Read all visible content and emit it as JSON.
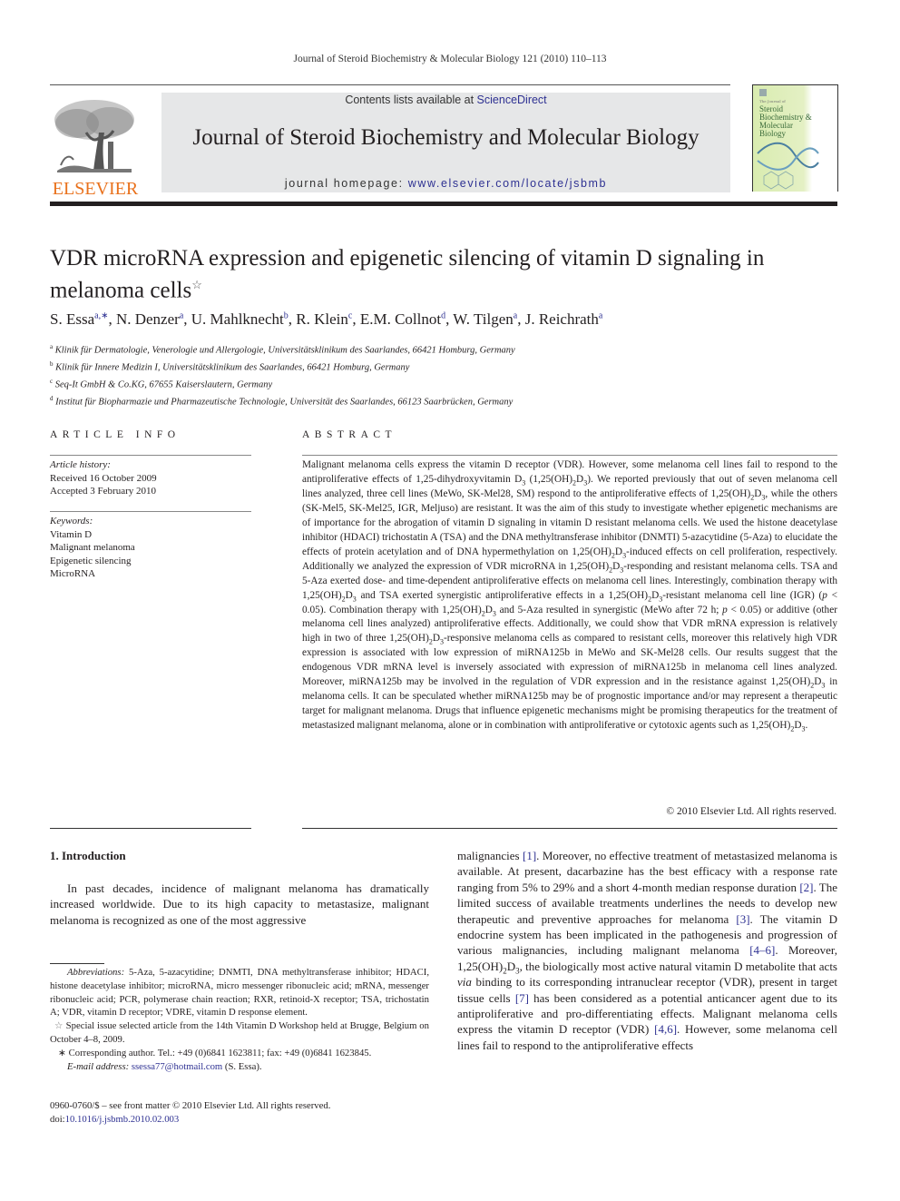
{
  "running_head": "Journal of Steroid Biochemistry & Molecular Biology 121 (2010) 110–113",
  "publisher": {
    "logo_icon": "elsevier-tree-icon",
    "name": "ELSEVIER",
    "brand_color": "#e9711c"
  },
  "banner": {
    "contents_prefix": "Contents lists available at ",
    "contents_link": "ScienceDirect",
    "journal_title": "Journal of Steroid Biochemistry and Molecular Biology",
    "homepage_prefix": "journal homepage: ",
    "homepage_link": "www.elsevier.com/locate/jsbmb",
    "background": "#e6e7e8",
    "link_color": "#2e3192"
  },
  "cover": {
    "small_text": "The Journal of",
    "title_lines": [
      "Steroid",
      "Biochemistry &",
      "Molecular",
      "Biology"
    ]
  },
  "article": {
    "title_line1": "VDR microRNA expression and epigenetic silencing of vitamin D signaling in",
    "title_line2": "melanoma cells",
    "title_note": "☆",
    "authors": [
      {
        "name": "S. Essa",
        "sup": "a,∗"
      },
      {
        "name": "N. Denzer",
        "sup": "a"
      },
      {
        "name": "U. Mahlknecht",
        "sup": "b"
      },
      {
        "name": "R. Klein",
        "sup": "c"
      },
      {
        "name": "E.M. Collnot",
        "sup": "d"
      },
      {
        "name": "W. Tilgen",
        "sup": "a"
      },
      {
        "name": "J. Reichrath",
        "sup": "a"
      }
    ],
    "affiliations": [
      {
        "key": "a",
        "text": "Klinik für Dermatologie, Venerologie und Allergologie, Universitätsklinikum des Saarlandes, 66421 Homburg, Germany"
      },
      {
        "key": "b",
        "text": "Klinik für Innere Medizin I, Universitätsklinikum des Saarlandes, 66421 Homburg, Germany"
      },
      {
        "key": "c",
        "text": "Seq-It GmbH & Co.KG, 67655 Kaiserslautern, Germany"
      },
      {
        "key": "d",
        "text": "Institut für Biopharmazie und Pharmazeutische Technologie, Universität des Saarlandes, 66123 Saarbrücken, Germany"
      }
    ]
  },
  "article_info": {
    "heading": "ARTICLE INFO",
    "history_label": "Article history:",
    "received": "Received 16 October 2009",
    "accepted": "Accepted 3 February 2010",
    "keywords_label": "Keywords:",
    "keywords": [
      "Vitamin D",
      "Malignant melanoma",
      "Epigenetic silencing",
      "MicroRNA"
    ]
  },
  "abstract": {
    "heading": "ABSTRACT",
    "segments": [
      "Malignant melanoma cells express the vitamin D receptor (VDR). However, some melanoma cell lines fail to respond to the antiproliferative effects of 1,25-dihydroxyvitamin D",
      "3",
      " (1,25(OH)",
      "2",
      "D",
      "3",
      "). We reported previously that out of seven melanoma cell lines analyzed, three cell lines (MeWo, SK-Mel28, SM) respond to the antiproliferative effects of 1,25(OH)",
      "2",
      "D",
      "3",
      ", while the others (SK-Mel5, SK-Mel25, IGR, Meljuso) are resistant. It was the aim of this study to investigate whether epigenetic mechanisms are of importance for the abrogation of vitamin D signaling in vitamin D resistant melanoma cells. We used the histone deacetylase inhibitor (HDACI) trichostatin A (TSA) and the DNA methyltransferase inhibitor (DNMTI) 5-azacytidine (5-Aza) to elucidate the effects of protein acetylation and of DNA hypermethylation on 1,25(OH)",
      "2",
      "D",
      "3",
      "-induced effects on cell proliferation, respectively. Additionally we analyzed the expression of VDR microRNA in 1,25(OH)",
      "2",
      "D",
      "3",
      "-responding and resistant melanoma cells. TSA and 5-Aza exerted dose- and time-dependent antiproliferative effects on melanoma cell lines. Interestingly, combination therapy with 1,25(OH)",
      "2",
      "D",
      "3",
      " and TSA exerted synergistic antiproliferative effects in a 1,25(OH)",
      "2",
      "D",
      "3",
      "-resistant melanoma cell line (IGR) (",
      "p",
      " < 0.05). Combination therapy with 1,25(OH)",
      "2",
      "D",
      "3",
      " and 5-Aza resulted in synergistic (MeWo after 72 h; ",
      "p",
      " < 0.05) or additive (other melanoma cell lines analyzed) antiproliferative effects. Additionally, we could show that VDR mRNA expression is relatively high in two of three 1,25(OH)",
      "2",
      "D",
      "3",
      "-responsive melanoma cells as compared to resistant cells, moreover this relatively high VDR expression is associated with low expression of miRNA125b in MeWo and SK-Mel28 cells. Our results suggest that the endogenous VDR mRNA level is inversely associated with expression of miRNA125b in melanoma cell lines analyzed. Moreover, miRNA125b may be involved in the regulation of VDR expression and in the resistance against 1,25(OH)",
      "2",
      "D",
      "3",
      " in melanoma cells. It can be speculated whether miRNA125b may be of prognostic importance and/or may represent a therapeutic target for malignant melanoma. Drugs that influence epigenetic mechanisms might be promising therapeutics for the treatment of metastasized malignant melanoma, alone or in combination with antiproliferative or cytotoxic agents such as 1,25(OH)",
      "2",
      "D",
      "3",
      "."
    ],
    "copyright": "© 2010 Elsevier Ltd. All rights reserved."
  },
  "introduction": {
    "heading": "1.  Introduction",
    "left_text": "In past decades, incidence of malignant melanoma has dramatically increased worldwide. Due to its high capacity to metastasize, malignant melanoma is recognized as one of the most aggressive",
    "right": {
      "t1": "malignancies ",
      "r1": "[1]",
      "t2": ". Moreover, no effective treatment of metastasized melanoma is available. At present, dacarbazine has the best efficacy with a response rate ranging from 5% to 29% and a short 4-month median response duration ",
      "r2": "[2]",
      "t3": ". The limited success of available treatments underlines the needs to develop new therapeutic and preventive approaches for melanoma ",
      "r3": "[3]",
      "t4": ". The vitamin D endocrine system has been implicated in the pathogenesis and progression of various malignancies, including malignant melanoma ",
      "r4": "[4–6]",
      "t5": ". Moreover, 1,25(OH)",
      "s1": "2",
      "t6": "D",
      "s2": "3",
      "t7": ", the biologically most active natural vitamin D metabolite that acts ",
      "via": "via",
      "t8": " binding to its corresponding intranuclear receptor (VDR), present in target tissue cells ",
      "r5": "[7]",
      "t9": " has been considered as a potential anticancer agent due to its antiproliferative and pro-differentiating effects. Malignant melanoma cells express the vitamin D receptor (VDR) ",
      "r6": "[4,6]",
      "t10": ". However, some melanoma cell lines fail to respond to the antiproliferative effects"
    }
  },
  "footnotes": {
    "abbrev_label": "Abbreviations:",
    "abbrev_text": "  5-Aza, 5-azacytidine; DNMTI, DNA methyltransferase inhibitor; HDACI, histone deacetylase inhibitor; microRNA, micro messenger ribonucleic acid; mRNA, messenger ribonucleic acid; PCR, polymerase chain reaction; RXR, retinoid-X receptor; TSA, trichostatin A; VDR, vitamin D receptor; VDRE, vitamin D response element.",
    "star_mark": "☆",
    "star_text": " Special issue selected article from the 14th Vitamin D Workshop held at Brugge, Belgium on October 4–8, 2009.",
    "corr_mark": "∗",
    "corr_text": " Corresponding author. Tel.: +49 (0)6841 1623811; fax: +49 (0)6841 1623845.",
    "email_label": "E-mail address:",
    "email": "ssessa77@hotmail.com",
    "email_suffix": " (S. Essa)."
  },
  "front_matter": {
    "issn_line": "0960-0760/$ – see front matter © 2010 Elsevier Ltd. All rights reserved.",
    "doi_prefix": "doi:",
    "doi": "10.1016/j.jsbmb.2010.02.003"
  }
}
